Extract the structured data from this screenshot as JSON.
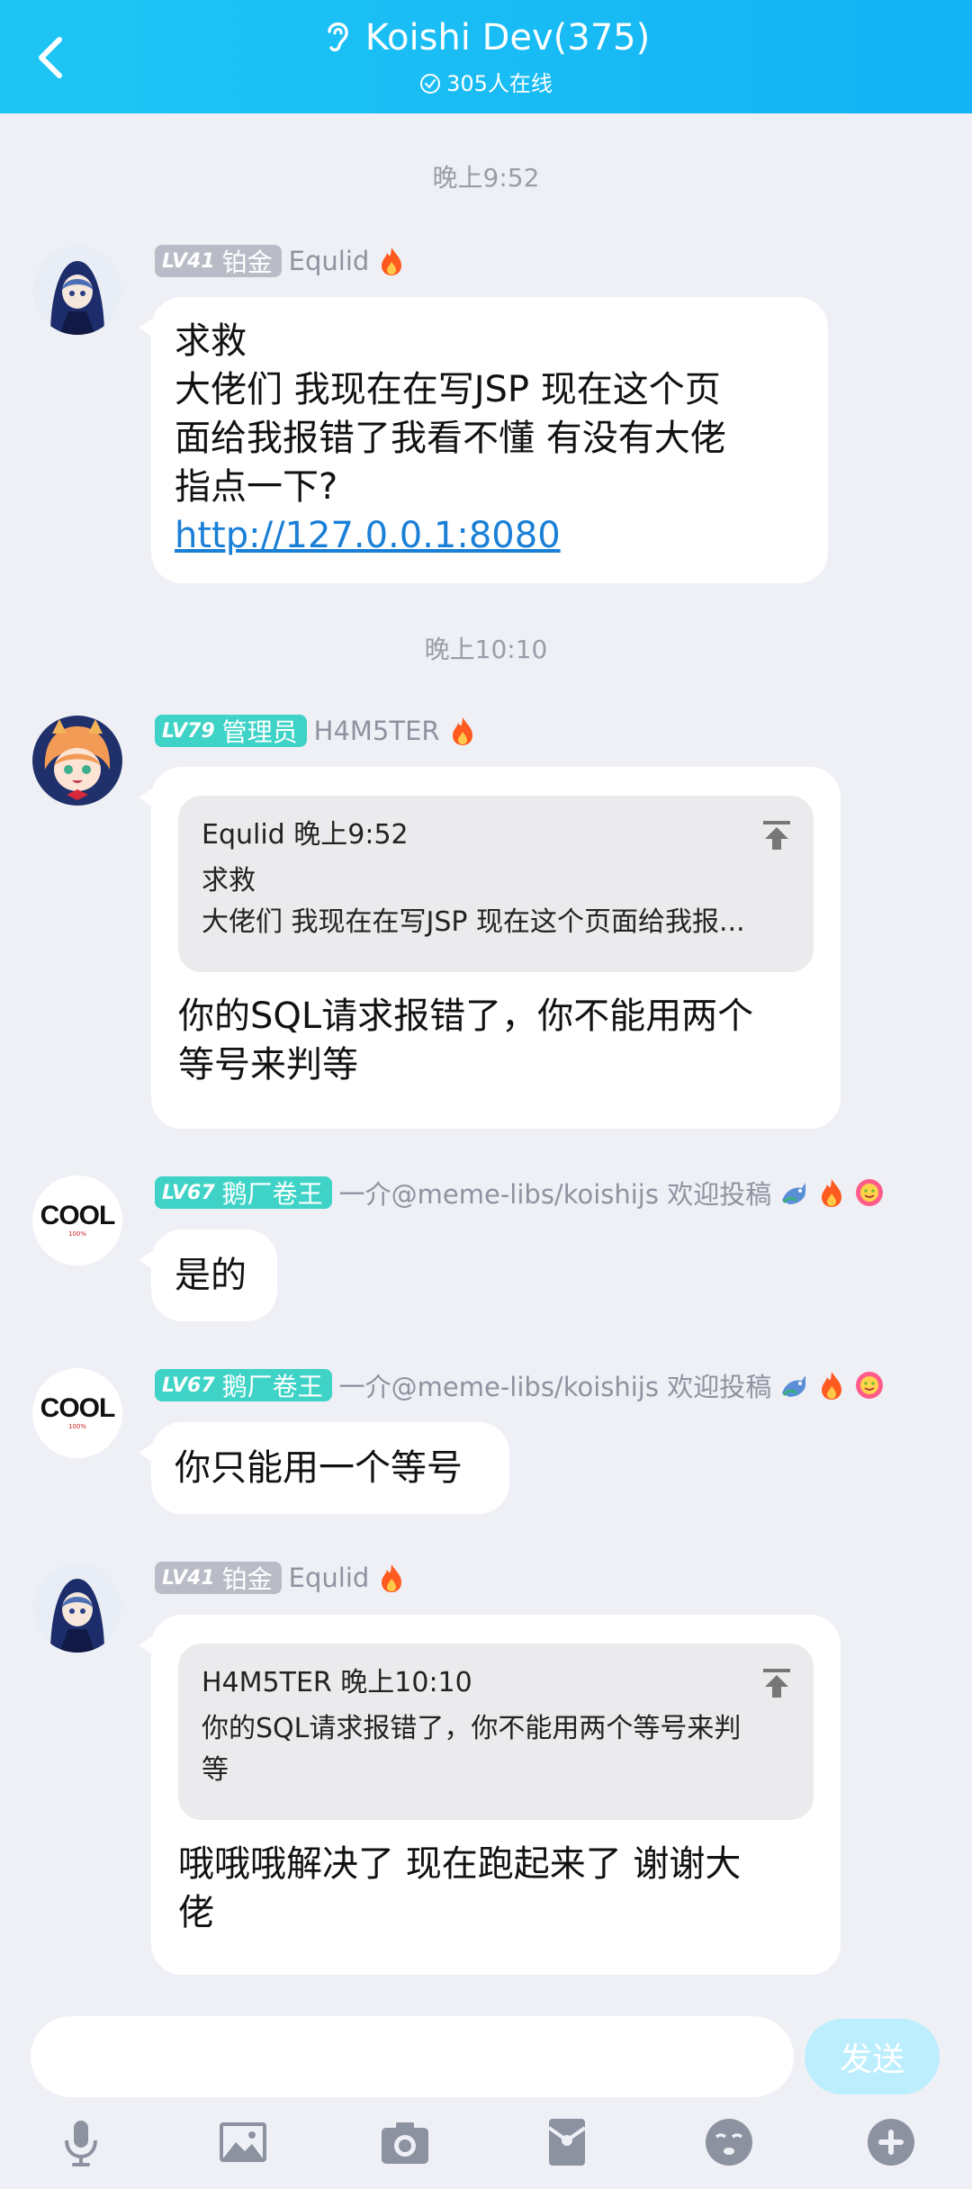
{
  "header": {
    "title": "Koishi Dev(375)",
    "subtitle": "305人在线"
  },
  "messages": [
    {
      "time": "晚上9:52",
      "level": "LV41",
      "title": "铂金",
      "name": "Equlid",
      "lines": [
        "求救",
        "大佬们  我现在在写JSP  现在这个页",
        "面给我报错了我看不懂  有没有大佬",
        "指点一下?"
      ],
      "link": "http://127.0.0.1:8080"
    },
    {
      "time": "晚上10:10",
      "level": "LV79",
      "title": "管理员",
      "name": "H4M5TER",
      "quote_head": "Equlid 晚上9:52",
      "quote_lines": [
        "求救",
        "大佬们  我现在在写JSP  现在这个页面给我报..."
      ],
      "lines": [
        "你的SQL请求报错了，你不能用两个",
        "等号来判等"
      ]
    },
    {
      "level": "LV67",
      "title": "鹅厂卷王",
      "name": "一介@meme-libs/koishijs 欢迎投稿",
      "avatar_text": "COOL",
      "avatar_sub": "100%",
      "lines": [
        "是的"
      ]
    },
    {
      "level": "LV67",
      "title": "鹅厂卷王",
      "name": "一介@meme-libs/koishijs 欢迎投稿",
      "avatar_text": "COOL",
      "avatar_sub": "100%",
      "lines": [
        "你只能用一个等号"
      ]
    },
    {
      "level": "LV41",
      "title": "铂金",
      "name": "Equlid",
      "quote_head": "H4M5TER 晚上10:10",
      "quote_lines": [
        " 你的SQL请求报错了，你不能用两个等号来判",
        "等"
      ],
      "lines": [
        "哦哦哦解决了  现在跑起来了  谢谢大",
        "佬"
      ]
    }
  ],
  "composer": {
    "send_label": "发送"
  },
  "toolbar": [
    "microphone-icon",
    "image-icon",
    "camera-icon",
    "red-packet-icon",
    "emoji-icon",
    "plus-icon"
  ],
  "colors": {
    "header": "#14b3f5",
    "link": "#1a7fd6",
    "badge_gray": "#b9bcc7",
    "badge_teal": "#3ed3c6",
    "send_disabled": "#bdeefe"
  }
}
